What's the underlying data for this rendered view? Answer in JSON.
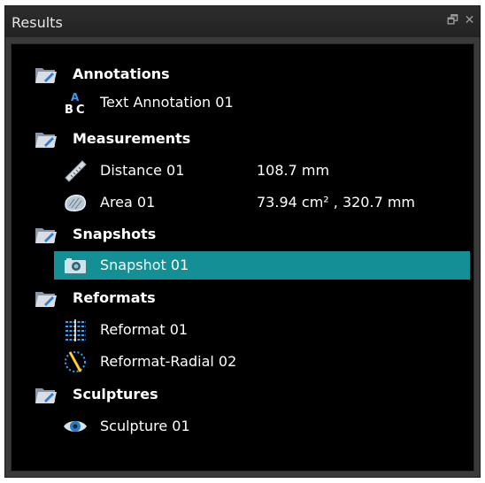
{
  "window": {
    "title": "Results"
  },
  "groups": [
    {
      "label": "Annotations",
      "icon": "folder-icon",
      "items": [
        {
          "label": "Text Annotation 01",
          "value": "",
          "icon": "text-annotation-icon"
        }
      ]
    },
    {
      "label": "Measurements",
      "icon": "folder-icon",
      "items": [
        {
          "label": "Distance 01",
          "value": "108.7 mm",
          "icon": "ruler-icon"
        },
        {
          "label": "Area 01",
          "value": "73.94 cm² , 320.7 mm",
          "icon": "area-icon"
        }
      ]
    },
    {
      "label": "Snapshots",
      "icon": "folder-icon",
      "items": [
        {
          "label": "Snapshot 01",
          "value": "",
          "icon": "camera-icon",
          "selected": true
        }
      ]
    },
    {
      "label": "Reformats",
      "icon": "folder-icon",
      "items": [
        {
          "label": "Reformat 01",
          "value": "",
          "icon": "reformat-icon"
        },
        {
          "label": "Reformat-Radial 02",
          "value": "",
          "icon": "reformat-radial-icon"
        }
      ]
    },
    {
      "label": "Sculptures",
      "icon": "folder-icon",
      "items": [
        {
          "label": "Sculpture 01",
          "value": "",
          "icon": "eye-icon"
        }
      ]
    }
  ],
  "colors": {
    "selection": "#148f96",
    "background": "#000000",
    "text": "#ffffff"
  }
}
